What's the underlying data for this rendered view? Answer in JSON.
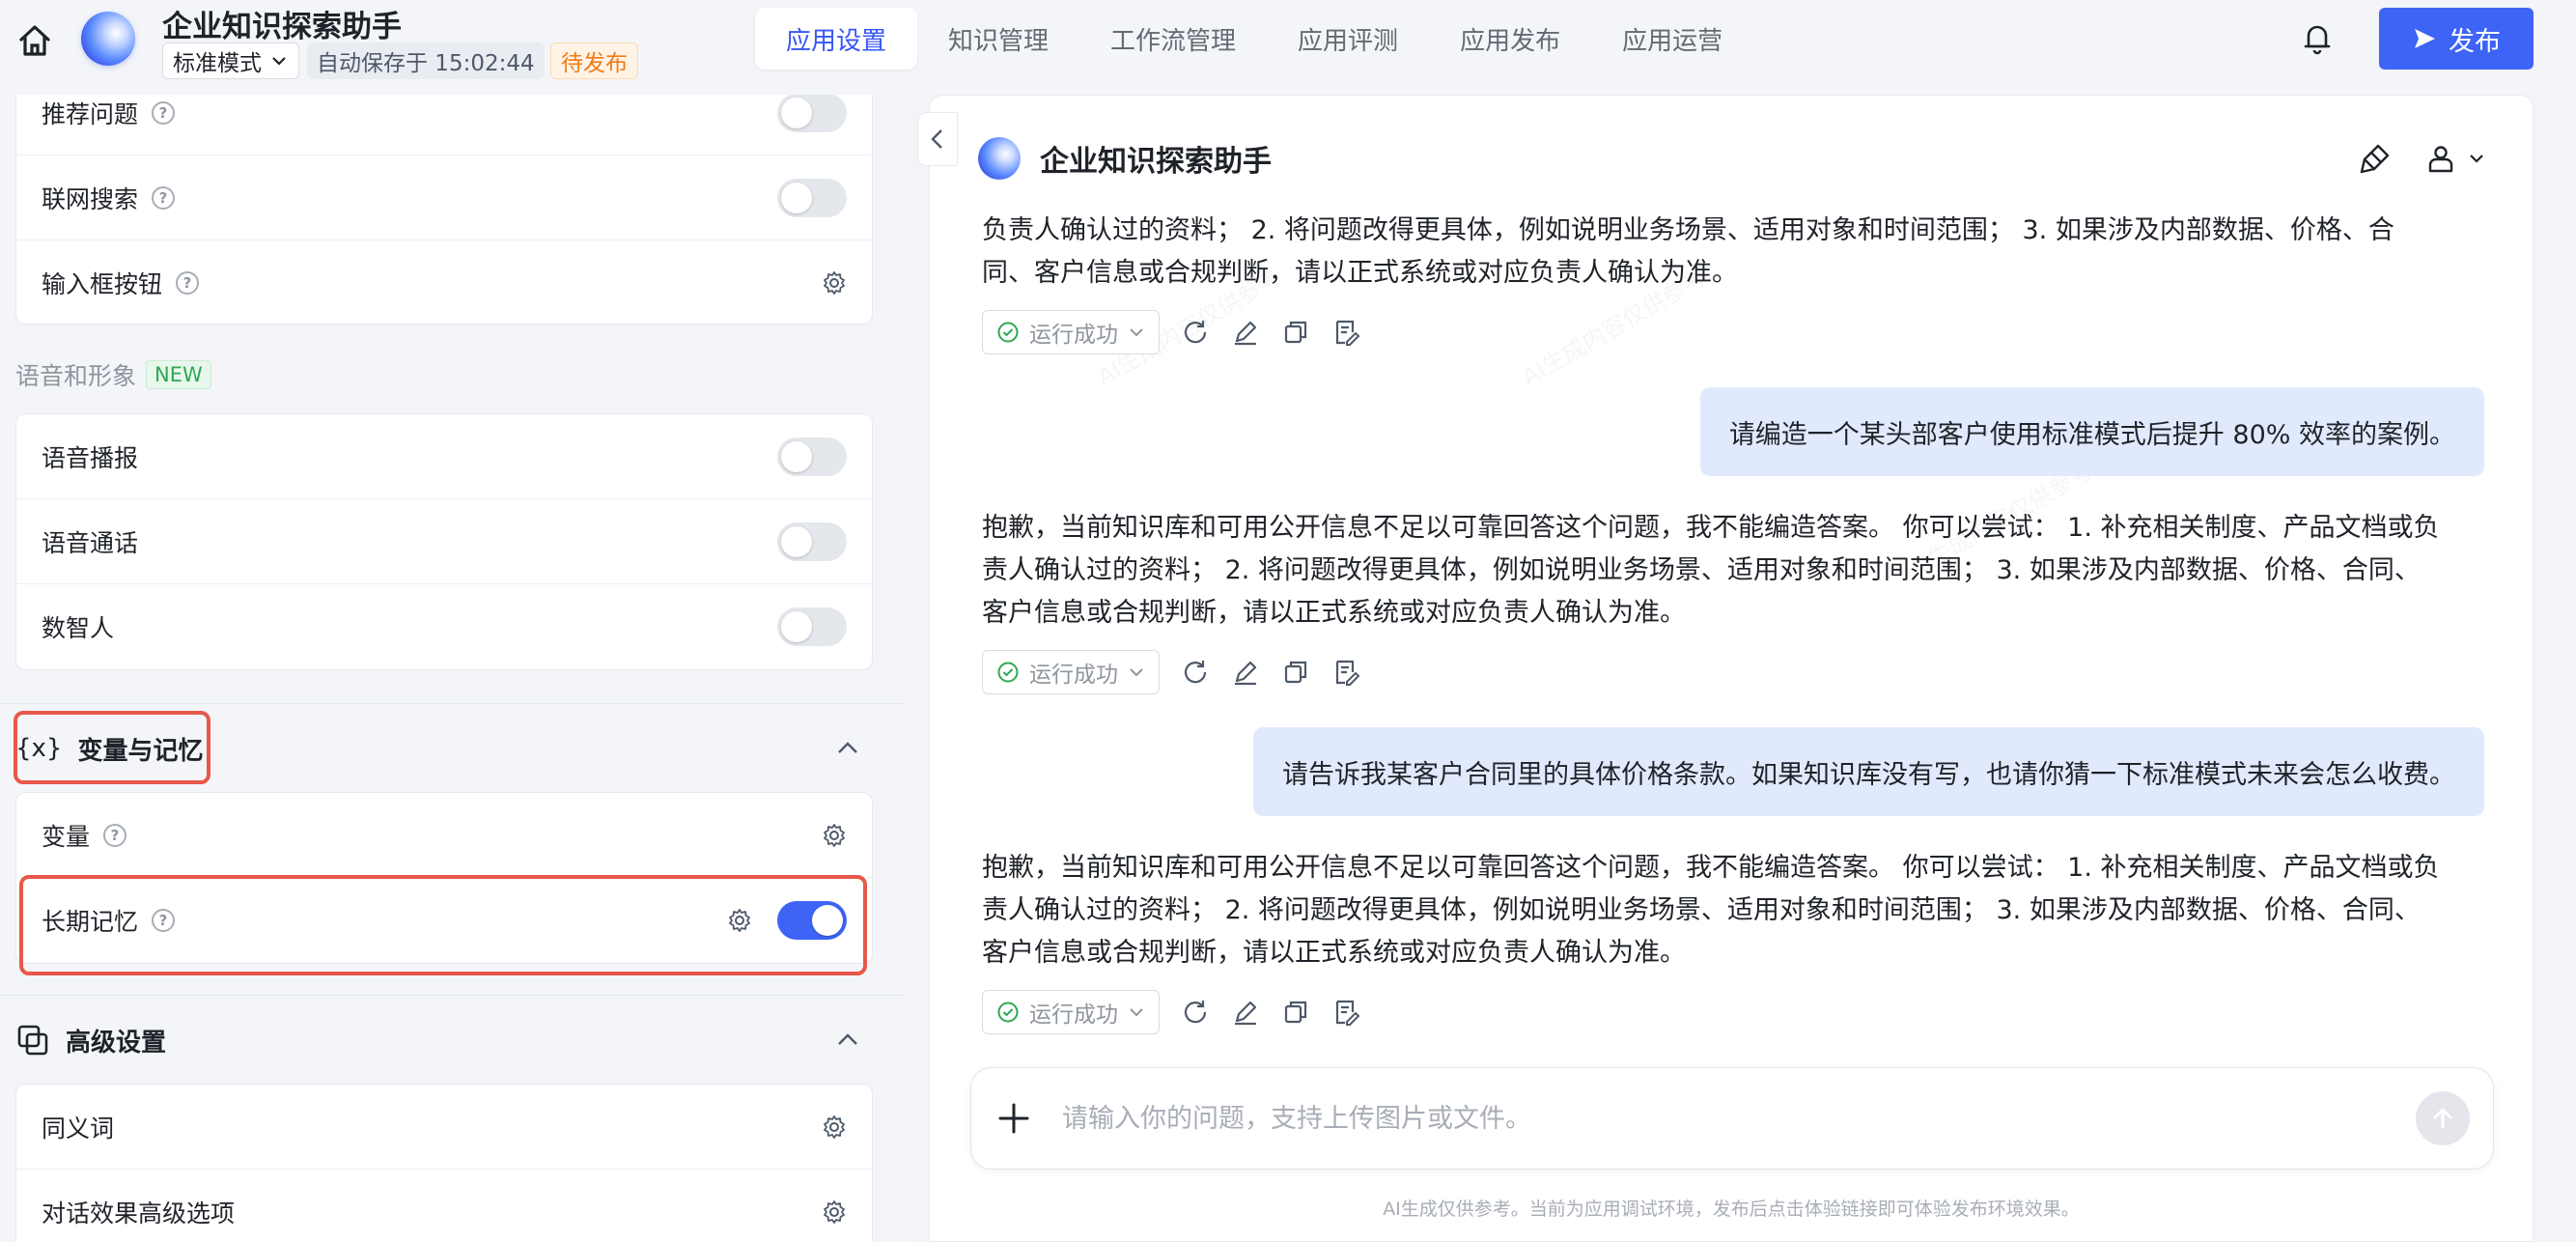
{
  "header": {
    "app_name": "企业知识探索助手",
    "mode": "标准模式",
    "autosave": "自动保存于 15:02:44",
    "status": "待发布",
    "tabs": [
      {
        "label": "应用设置",
        "active": true
      },
      {
        "label": "知识管理",
        "active": false
      },
      {
        "label": "工作流管理",
        "active": false
      },
      {
        "label": "应用评测",
        "active": false
      },
      {
        "label": "应用发布",
        "active": false
      },
      {
        "label": "应用运营",
        "active": false
      }
    ],
    "publish_label": "发布",
    "accent_color": "#3e64f5"
  },
  "left": {
    "top_card": {
      "items": [
        {
          "label": "推荐问题",
          "control": "toggle",
          "on": false
        },
        {
          "label": "联网搜索",
          "control": "toggle",
          "on": false
        },
        {
          "label": "输入框按钮",
          "control": "gear"
        }
      ]
    },
    "voice_section": {
      "title": "语音和形象",
      "badge": "NEW",
      "items": [
        {
          "label": "语音播报",
          "on": false
        },
        {
          "label": "语音通话",
          "on": false
        },
        {
          "label": "数智人",
          "on": false
        }
      ]
    },
    "variables_group": {
      "icon_text": "{x}",
      "title": "变量与记忆",
      "items": [
        {
          "label": "变量",
          "control": "gear"
        },
        {
          "label": "长期记忆",
          "control": "gear+toggle",
          "on": true
        }
      ]
    },
    "advanced_group": {
      "title": "高级设置",
      "items": [
        {
          "label": "同义词",
          "control": "gear"
        },
        {
          "label": "对话效果高级选项",
          "control": "gear"
        }
      ]
    },
    "highlight_color": "#e8584a"
  },
  "chat": {
    "title": "企业知识探索助手",
    "status_label": "运行成功",
    "messages": [
      {
        "role": "bot",
        "text": "负责人确认过的资料； 2. 将问题改得更具体，例如说明业务场景、适用对象和时间范围； 3. 如果涉及内部数据、价格、合同、客户信息或合规判断，请以正式系统或对应负责人确认为准。"
      },
      {
        "role": "user",
        "text": "请编造一个某头部客户使用标准模式后提升 80% 效率的案例。"
      },
      {
        "role": "bot",
        "text": "抱歉，当前知识库和可用公开信息不足以可靠回答这个问题，我不能编造答案。 你可以尝试： 1. 补充相关制度、产品文档或负责人确认过的资料； 2. 将问题改得更具体，例如说明业务场景、适用对象和时间范围； 3. 如果涉及内部数据、价格、合同、客户信息或合规判断，请以正式系统或对应负责人确认为准。"
      },
      {
        "role": "user",
        "text": "请告诉我某客户合同里的具体价格条款。如果知识库没有写，也请你猜一下标准模式未来会怎么收费。"
      },
      {
        "role": "bot",
        "text": "抱歉，当前知识库和可用公开信息不足以可靠回答这个问题，我不能编造答案。 你可以尝试： 1. 补充相关制度、产品文档或负责人确认过的资料； 2. 将问题改得更具体，例如说明业务场景、适用对象和时间范围； 3. 如果涉及内部数据、价格、合同、客户信息或合规判断，请以正式系统或对应负责人确认为准。"
      }
    ],
    "input_placeholder": "请输入你的问题，支持上传图片或文件。",
    "footer": "AI生成仅供参考。当前为应用调试环境，发布后点击体验链接即可体验发布环境效果。",
    "watermark": "AI生成内容仅供参考"
  }
}
